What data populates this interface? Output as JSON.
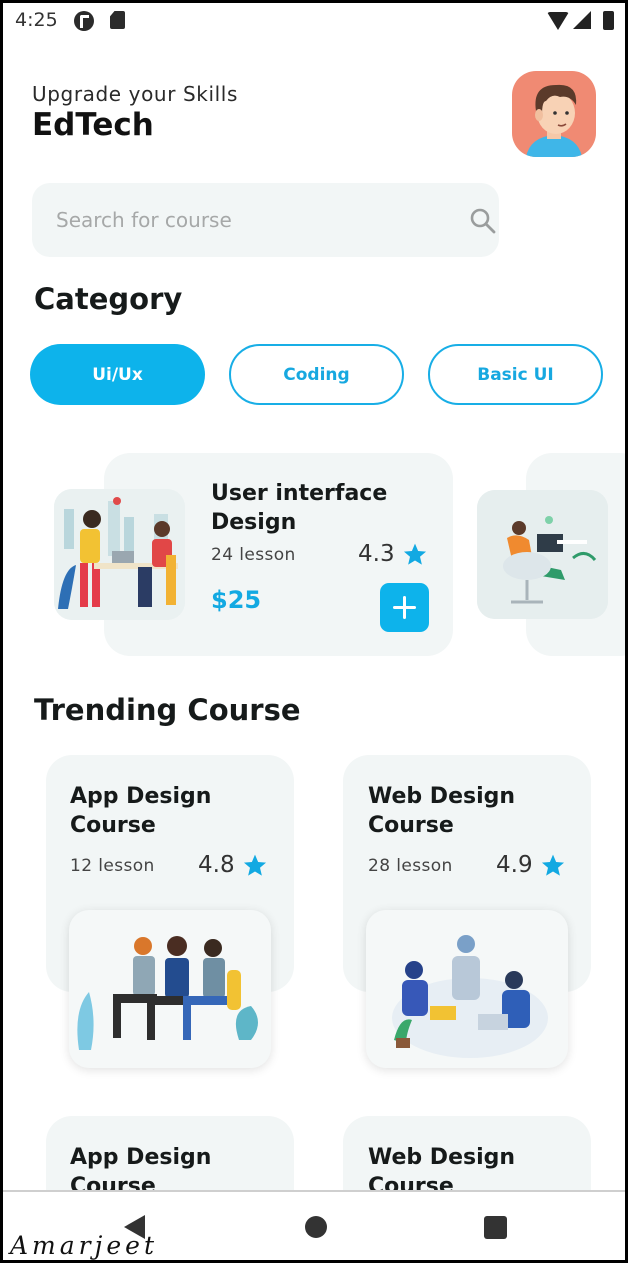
{
  "status_bar": {
    "time": "4:25"
  },
  "header": {
    "subtitle": "Upgrade your Skills",
    "title": "EdTech"
  },
  "search": {
    "placeholder": "Search for course"
  },
  "category": {
    "title": "Category",
    "chips": [
      {
        "label": "Ui/Ux",
        "selected": true
      },
      {
        "label": "Coding",
        "selected": false
      },
      {
        "label": "Basic UI",
        "selected": false
      }
    ]
  },
  "featured": [
    {
      "title": "User interface Design",
      "lessons": "24 lesson",
      "rating": "4.3",
      "price": "$25"
    }
  ],
  "trending": {
    "title": "Trending Course",
    "courses": [
      {
        "title": "App Design Course",
        "lessons": "12 lesson",
        "rating": "4.8"
      },
      {
        "title": "Web Design Course",
        "lessons": "28 lesson",
        "rating": "4.9"
      },
      {
        "title": "App Design Course"
      },
      {
        "title": "Web Design Course"
      }
    ]
  },
  "signature": "Amarjeet",
  "colors": {
    "accent": "#0db3eb",
    "card_bg": "#f2f6f6",
    "star": "#12a9e2"
  }
}
